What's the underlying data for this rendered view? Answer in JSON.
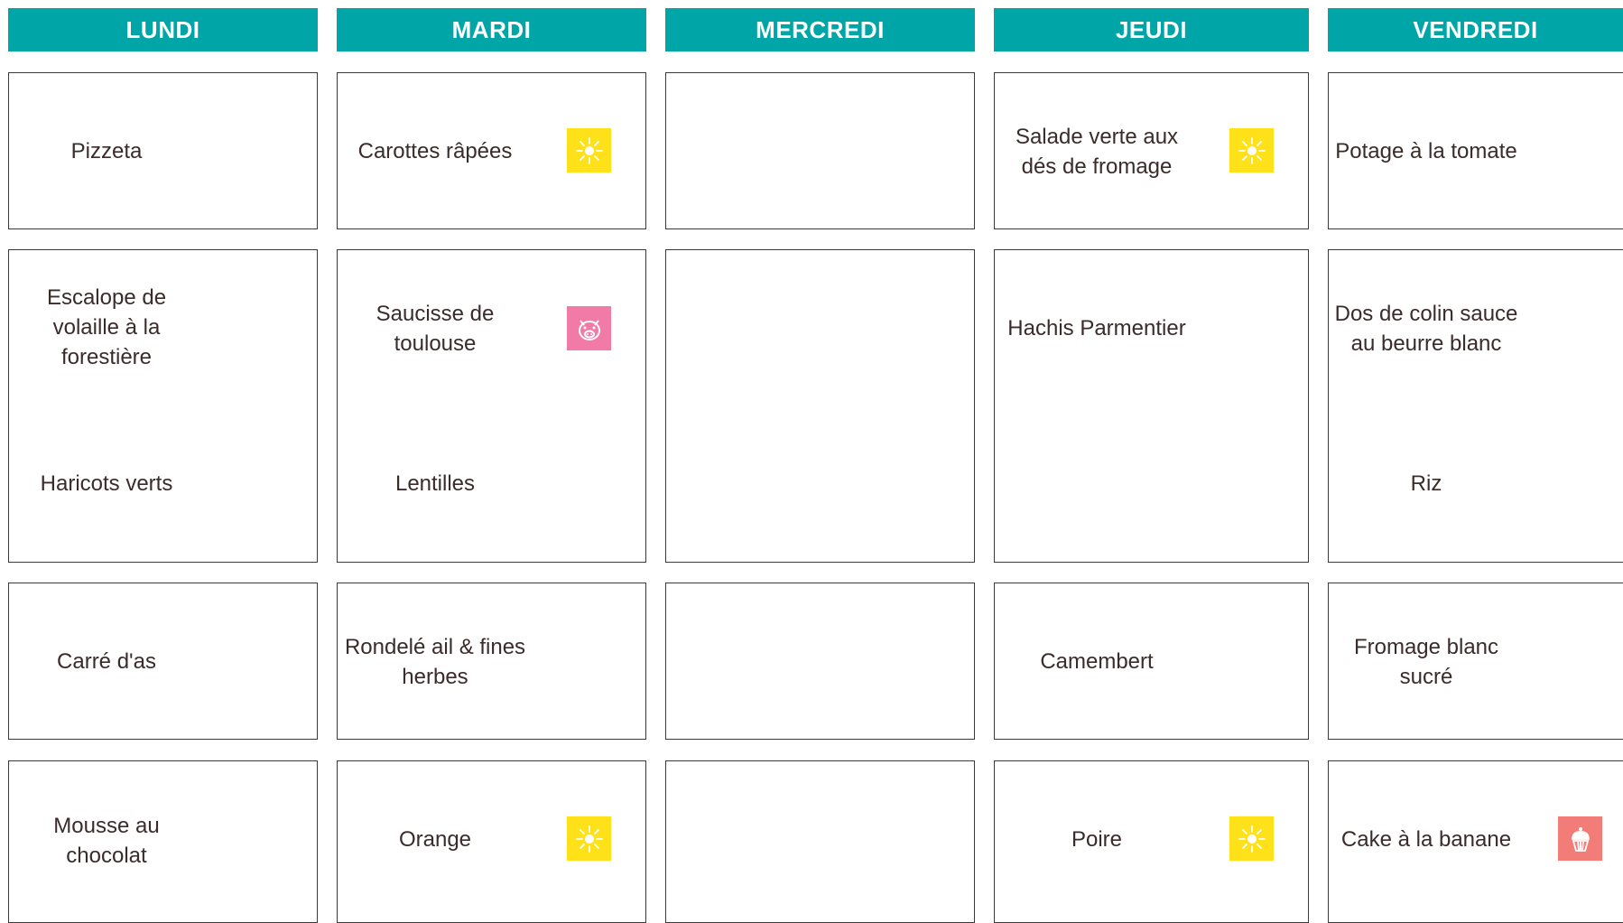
{
  "days": [
    "LUNDI",
    "MARDI",
    "MERCREDI",
    "JEUDI",
    "VENDREDI"
  ],
  "lundi": {
    "entree": "Pizzeta",
    "plat": "Escalope de\nvolaille à la\nforestière",
    "accompagnement": "Haricots verts",
    "fromage": "Carré d'as",
    "dessert": "Mousse au\nchocolat"
  },
  "mardi": {
    "entree": "Carottes râpées",
    "plat": "Saucisse de\ntoulouse",
    "accompagnement": "Lentilles",
    "fromage": "Rondelé ail & fines\nherbes",
    "dessert": "Orange"
  },
  "jeudi": {
    "entree": "Salade verte aux\ndés de fromage",
    "plat": "Hachis Parmentier",
    "fromage": "Camembert",
    "dessert": "Poire"
  },
  "vendredi": {
    "entree": "Potage à la tomate",
    "plat": "Dos de colin sauce\nau beurre blanc",
    "accompagnement": "Riz",
    "fromage": "Fromage blanc\nsucré",
    "dessert": "Cake à la banane"
  },
  "icons": {
    "season": "sun-icon",
    "pork": "pig-icon",
    "homemade": "cupcake-icon"
  },
  "colors": {
    "header": "#00a5a8",
    "sun": "#ffe11a",
    "pig": "#f27aa6",
    "cake": "#f27c78"
  }
}
